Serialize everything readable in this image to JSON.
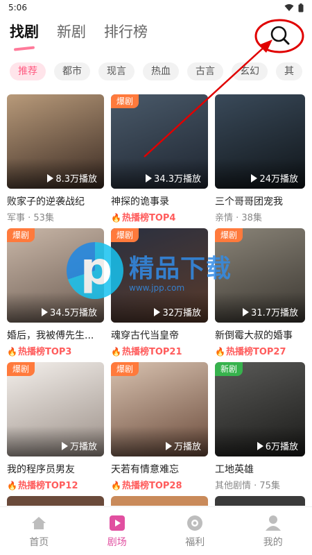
{
  "status": {
    "time": "5:06"
  },
  "top_tabs": [
    {
      "label": "找剧",
      "active": true
    },
    {
      "label": "新剧",
      "active": false
    },
    {
      "label": "排行榜",
      "active": false
    }
  ],
  "genres": [
    {
      "label": "推荐",
      "active": true
    },
    {
      "label": "都市"
    },
    {
      "label": "现言"
    },
    {
      "label": "热血"
    },
    {
      "label": "古言"
    },
    {
      "label": "玄幻"
    },
    {
      "label": "其"
    }
  ],
  "dramas": [
    {
      "title": "败家子的逆袭战纪",
      "badge": "",
      "plays": "8.3万播放",
      "sub": "军事 · 53集",
      "hot": false,
      "colors": [
        "#b89a7a",
        "#3a2a22"
      ]
    },
    {
      "title": "神探的诡事录",
      "badge": "爆剧",
      "plays": "34.3万播放",
      "sub": "热播榜TOP4",
      "hot": true,
      "colors": [
        "#4a5a6a",
        "#1e2530"
      ]
    },
    {
      "title": "三个哥哥团宠我",
      "badge": "",
      "plays": "24万播放",
      "sub": "亲情 · 38集",
      "hot": false,
      "colors": [
        "#3a4a5a",
        "#0f1418"
      ]
    },
    {
      "title": "婚后，我被傅先生...",
      "badge": "爆剧",
      "plays": "34.5万播放",
      "sub": "热播榜TOP3",
      "hot": true,
      "colors": [
        "#c9b7a8",
        "#6a5a50"
      ]
    },
    {
      "title": "魂穿古代当皇帝",
      "badge": "爆剧",
      "plays": "32万播放",
      "sub": "热播榜TOP21",
      "hot": true,
      "colors": [
        "#2a3040",
        "#5a3a2a"
      ]
    },
    {
      "title": "新倒霉大叔的婚事",
      "badge": "爆剧",
      "plays": "31.7万播放",
      "sub": "热播榜TOP27",
      "hot": true,
      "colors": [
        "#8a8478",
        "#3a3630"
      ]
    },
    {
      "title": "我的程序员男友",
      "badge": "爆剧",
      "plays": "万播放",
      "sub": "热播榜TOP12",
      "hot": true,
      "colors": [
        "#f4f0ec",
        "#9a8e86"
      ]
    },
    {
      "title": "天若有情意难忘",
      "badge": "爆剧",
      "plays": "万播放",
      "sub": "热播榜TOP28",
      "hot": true,
      "colors": [
        "#d8c2b0",
        "#6a4a3a"
      ]
    },
    {
      "title": "工地英雄",
      "badge": "新剧",
      "plays": "6万播放",
      "sub": "其他剧情 · 75集",
      "hot": false,
      "colors": [
        "#5a5a58",
        "#1a1a18"
      ]
    }
  ],
  "watermark": {
    "title": "精品下载",
    "url": "www.jpp.com"
  },
  "bottom_nav": [
    {
      "label": "首页",
      "active": false
    },
    {
      "label": "剧场",
      "active": true
    },
    {
      "label": "福利",
      "active": false
    },
    {
      "label": "我的",
      "active": false
    }
  ],
  "colors": {
    "accent": "#ff5c82",
    "hot": "#ff5c5c",
    "badge": "#ff7a3c",
    "nav_active": "#e14fa0",
    "annotation": "#e00000"
  }
}
